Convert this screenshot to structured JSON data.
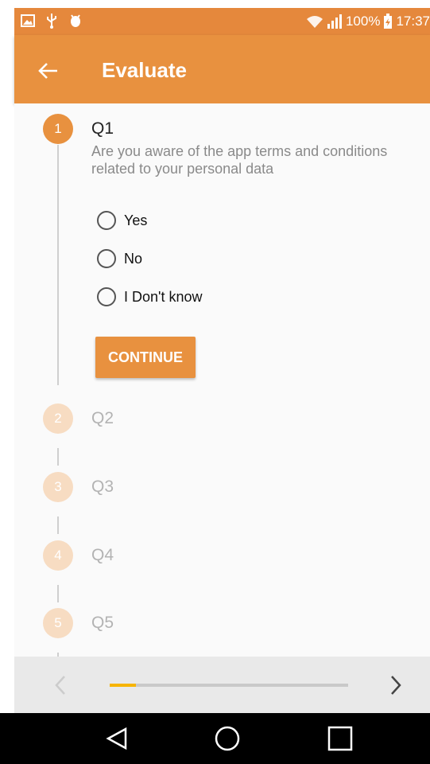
{
  "status_bar": {
    "battery": "100%",
    "time": "17:37",
    "icons": [
      "image-icon",
      "usb-icon",
      "android-debug-icon",
      "wifi-icon",
      "signal-icon",
      "battery-charging-icon"
    ]
  },
  "app_bar": {
    "title": "Evaluate",
    "back_icon": "arrow-left-icon"
  },
  "steps": [
    {
      "number": "1",
      "title": "Q1"
    },
    {
      "number": "2",
      "title": "Q2"
    },
    {
      "number": "3",
      "title": "Q3"
    },
    {
      "number": "4",
      "title": "Q4"
    },
    {
      "number": "5",
      "title": "Q5"
    }
  ],
  "question": {
    "text": "Are you aware of the app terms and conditions related to your personal data",
    "options": [
      "Yes",
      "No",
      "I Don't know"
    ],
    "continue_label": "CONTINUE"
  },
  "footer": {
    "progress": 0.11
  },
  "colors": {
    "accent": "#e8913f",
    "status_bar": "#e5883c",
    "step_inactive": "#f7dcc2",
    "progress": "#f7b400"
  }
}
